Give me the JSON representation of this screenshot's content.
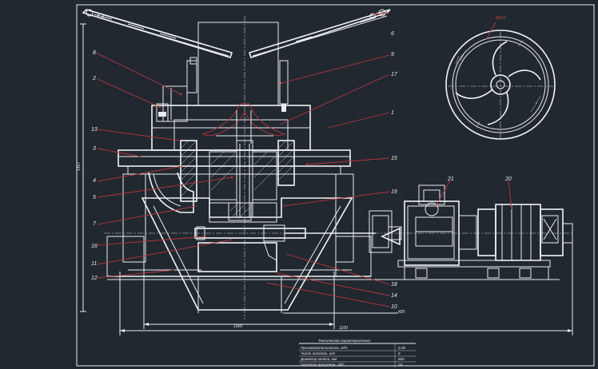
{
  "drawing": {
    "part_labels": {
      "left": [
        "8",
        "2",
        "13",
        "3",
        "4",
        "5",
        "7",
        "16",
        "11",
        "12"
      ],
      "right": [
        "6",
        "9",
        "17",
        "1",
        "19",
        "18",
        "21",
        "20",
        "15",
        "14",
        "10"
      ]
    },
    "dimensions": {
      "height": "1457",
      "base_width": "1000",
      "overall_width": "1100",
      "small": "420",
      "circle_dim": "Ø910"
    },
    "spec_table": {
      "title": "Техническая характеристика",
      "rows": [
        {
          "label": "Производительность, м³/с",
          "value": "0,38"
        },
        {
          "label": "Число лопаток, шт",
          "value": "8"
        },
        {
          "label": "Диаметр колеса, мм",
          "value": "600"
        },
        {
          "label": "Частота вращения, об/с",
          "value": "24"
        }
      ]
    }
  },
  "colors": {
    "background": "#212830",
    "lines": "#e9ecef",
    "leaders": "#b8353a"
  }
}
